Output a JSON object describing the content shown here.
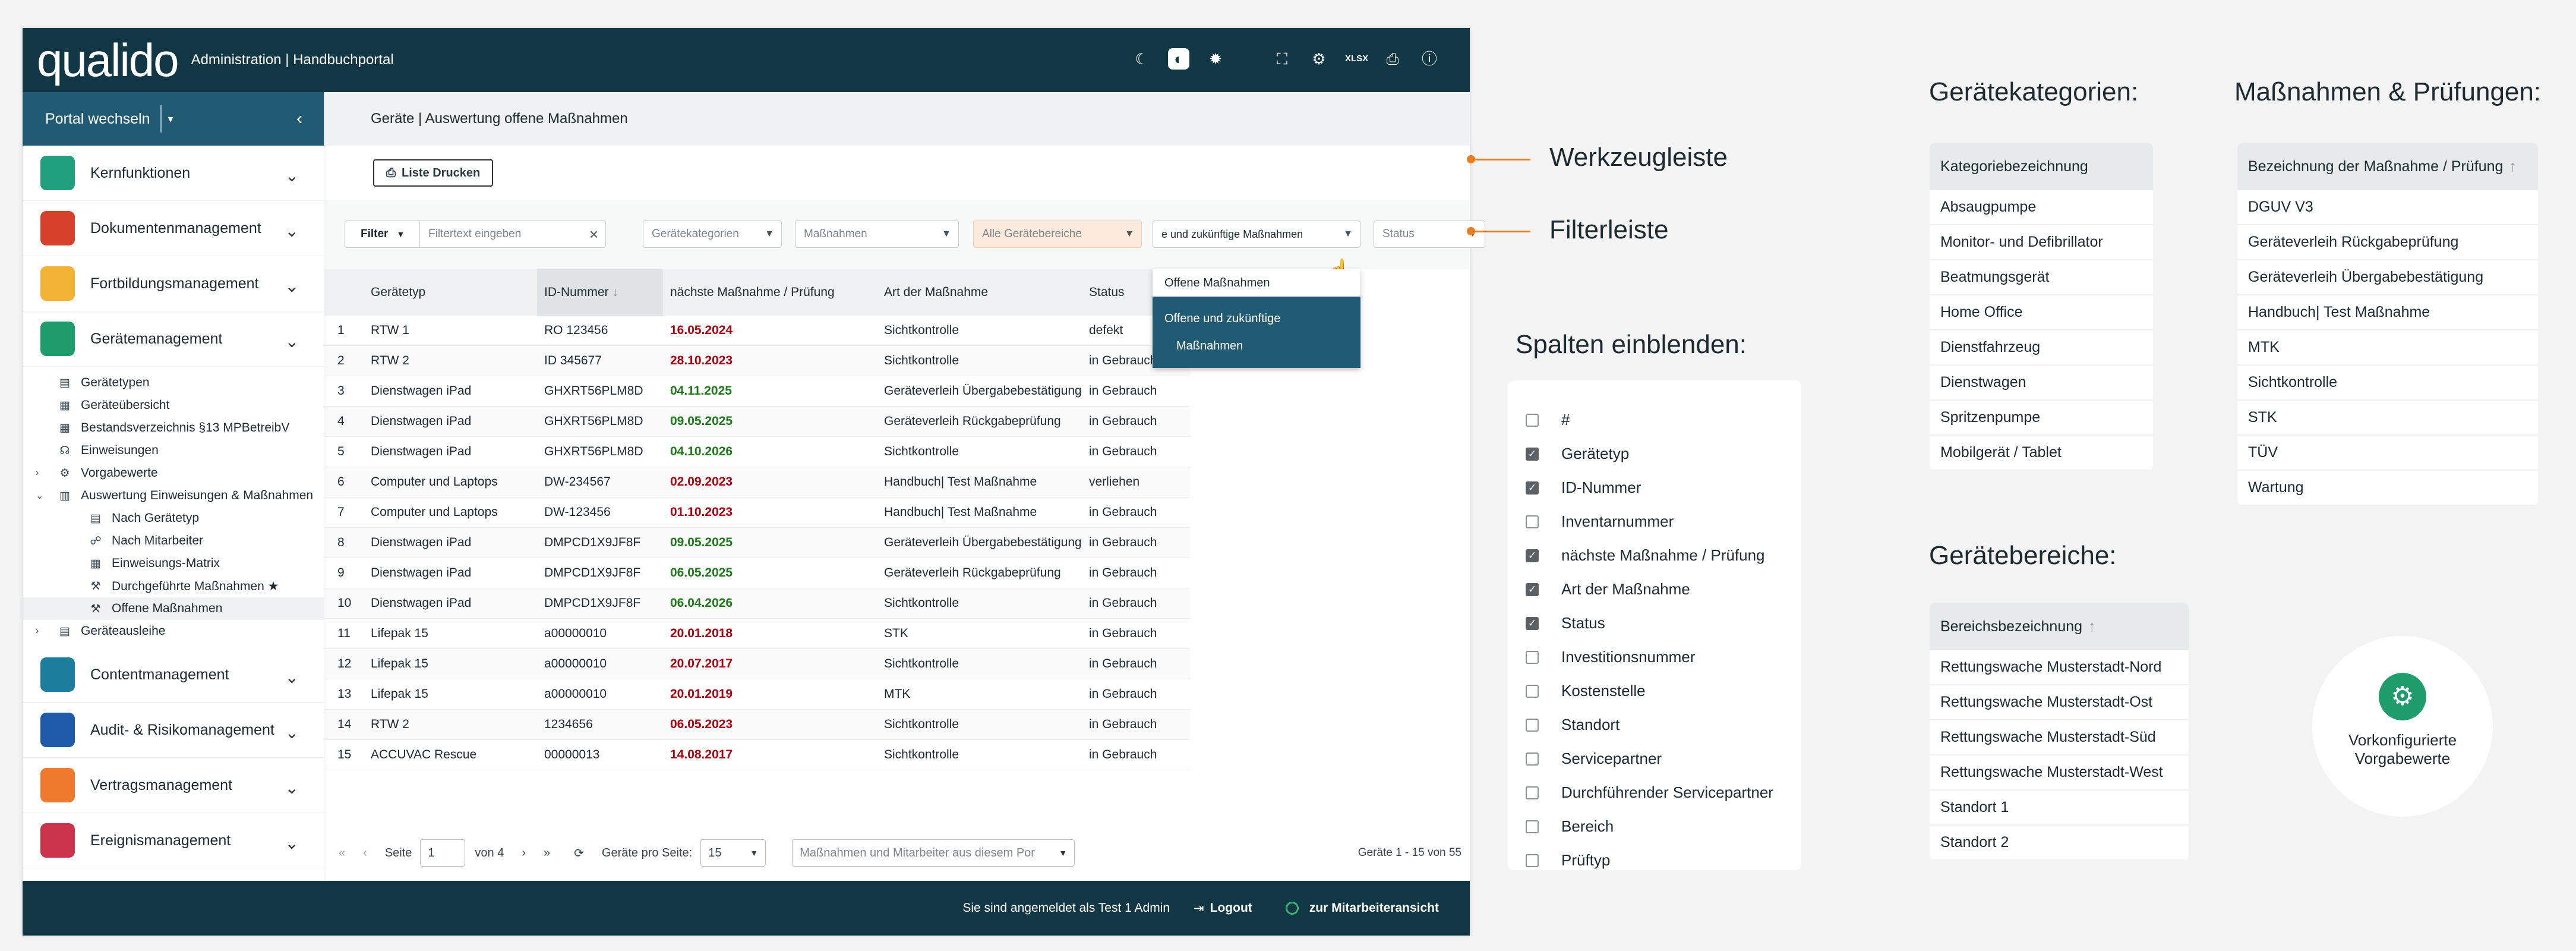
{
  "header": {
    "logo": "qualido",
    "title": "Administration | Handbuchportal"
  },
  "sidebar": {
    "portal_label": "Portal wechseln",
    "sections_top": [
      {
        "label": "Kernfunktionen",
        "color": "#20a07c"
      },
      {
        "label": "Dokumentenmanagement",
        "color": "#d6412c"
      },
      {
        "label": "Fortbildungsmanagement",
        "color": "#f2b233"
      },
      {
        "label": "Gerätemanagement",
        "color": "#1e9c6c"
      }
    ],
    "tree": [
      {
        "label": "Gerätetypen",
        "indent": 1
      },
      {
        "label": "Geräteübersicht",
        "indent": 1
      },
      {
        "label": "Bestandsverzeichnis §13 MPBetreibV",
        "indent": 1
      },
      {
        "label": "Einweisungen",
        "indent": 1
      },
      {
        "label": "Vorgabewerte",
        "indent": 1,
        "arrow": true
      },
      {
        "label": "Auswertung Einweisungen & Maßnahmen",
        "indent": 1,
        "arrow": true,
        "open": true
      },
      {
        "label": "Nach Gerätetyp",
        "indent": 2
      },
      {
        "label": "Nach Mitarbeiter",
        "indent": 2
      },
      {
        "label": "Einweisungs-Matrix",
        "indent": 2
      },
      {
        "label": "Durchgeführte Maßnahmen ★",
        "indent": 2
      },
      {
        "label": "Offene Maßnahmen",
        "indent": 2,
        "selected": true
      },
      {
        "label": "Geräteausleihe",
        "indent": 1,
        "arrow": true
      }
    ],
    "sections_bottom": [
      {
        "label": "Contentmanagement",
        "color": "#1d7d9c"
      },
      {
        "label": "Audit- & Risikomanagement",
        "color": "#1f5aa8"
      },
      {
        "label": "Vertragsmanagement",
        "color": "#ef7a2e"
      },
      {
        "label": "Ereignismanagement",
        "color": "#c9344a"
      }
    ]
  },
  "main": {
    "breadcrumb": "Geräte | Auswertung offene Maßnahmen",
    "print_button": "Liste Drucken",
    "filter": {
      "label": "Filter",
      "text_placeholder": "Filtertext eingeben",
      "categories": "Gerätekategorien",
      "measures": "Maßnahmen",
      "areas": "Alle Gerätebereiche",
      "open_select": "e und zukünftige Maßnahmen",
      "status": "Status"
    },
    "dropdown": {
      "option1": "Offene Maßnahmen",
      "option2_line1": "Offene und zukünftige",
      "option2_line2": "Maßnahmen"
    },
    "columns": [
      "",
      "Gerätetyp",
      "ID-Nummer",
      "nächste Maßnahme / Prüfung",
      "Art der Maßnahme",
      "Status"
    ],
    "rows": [
      [
        "1",
        "RTW 1",
        "RO 123456",
        "16.05.2024",
        "red",
        "Sichtkontrolle",
        "defekt"
      ],
      [
        "2",
        "RTW 2",
        "ID 345677",
        "28.10.2023",
        "red",
        "Sichtkontrolle",
        "in Gebrauch"
      ],
      [
        "3",
        "Dienstwagen iPad",
        "GHXRT56PLM8D",
        "04.11.2025",
        "green",
        "Geräteverleih Übergabebestätigung",
        "in Gebrauch"
      ],
      [
        "4",
        "Dienstwagen iPad",
        "GHXRT56PLM8D",
        "09.05.2025",
        "green",
        "Geräteverleih Rückgabeprüfung",
        "in Gebrauch"
      ],
      [
        "5",
        "Dienstwagen iPad",
        "GHXRT56PLM8D",
        "04.10.2026",
        "green",
        "Sichtkontrolle",
        "in Gebrauch"
      ],
      [
        "6",
        "Computer und Laptops",
        "DW-234567",
        "02.09.2023",
        "red",
        "Handbuch| Test Maßnahme",
        "verliehen"
      ],
      [
        "7",
        "Computer und Laptops",
        "DW-123456",
        "01.10.2023",
        "red",
        "Handbuch| Test Maßnahme",
        "in Gebrauch"
      ],
      [
        "8",
        "Dienstwagen iPad",
        "DMPCD1X9JF8F",
        "09.05.2025",
        "green",
        "Geräteverleih Übergabebestätigung",
        "in Gebrauch"
      ],
      [
        "9",
        "Dienstwagen iPad",
        "DMPCD1X9JF8F",
        "06.05.2025",
        "green",
        "Geräteverleih Rückgabeprüfung",
        "in Gebrauch"
      ],
      [
        "10",
        "Dienstwagen iPad",
        "DMPCD1X9JF8F",
        "06.04.2026",
        "green",
        "Sichtkontrolle",
        "in Gebrauch"
      ],
      [
        "11",
        "Lifepak 15",
        "a00000010",
        "20.01.2018",
        "red",
        "STK",
        "in Gebrauch"
      ],
      [
        "12",
        "Lifepak 15",
        "a00000010",
        "20.07.2017",
        "red",
        "Sichtkontrolle",
        "in Gebrauch"
      ],
      [
        "13",
        "Lifepak 15",
        "a00000010",
        "20.01.2019",
        "red",
        "MTK",
        "in Gebrauch"
      ],
      [
        "14",
        "RTW 2",
        "1234656",
        "06.05.2023",
        "red",
        "Sichtkontrolle",
        "in Gebrauch"
      ],
      [
        "15",
        "ACCUVAC Rescue",
        "00000013",
        "14.08.2017",
        "red",
        "Sichtkontrolle",
        "in Gebrauch"
      ]
    ],
    "pager": {
      "page_label": "Seite",
      "page_value": "1",
      "of": "von 4",
      "per_page_label": "Geräte pro Seite:",
      "per_page": "15",
      "scope": "Maßnahmen und Mitarbeiter aus diesem Por",
      "count": "Geräte 1 - 15 von 55"
    }
  },
  "footer": {
    "logged_in": "Sie sind angemeldet als Test 1 Admin",
    "logout": "Logout",
    "employee_view": "zur Mitarbeiteransicht"
  },
  "annotations": {
    "toolbar": "Werkzeugleiste",
    "filterbar": "Filterleiste"
  },
  "columns_panel": {
    "title": "Spalten einblenden:",
    "items": [
      {
        "label": "#",
        "on": false
      },
      {
        "label": "Gerätetyp",
        "on": true
      },
      {
        "label": "ID-Nummer",
        "on": true
      },
      {
        "label": "Inventarnummer",
        "on": false
      },
      {
        "label": "nächste Maßnahme / Prüfung",
        "on": true
      },
      {
        "label": "Art der Maßnahme",
        "on": true
      },
      {
        "label": "Status",
        "on": true
      },
      {
        "label": "Investitionsnummer",
        "on": false
      },
      {
        "label": "Kostenstelle",
        "on": false
      },
      {
        "label": "Standort",
        "on": false
      },
      {
        "label": "Servicepartner",
        "on": false
      },
      {
        "label": "Durchführender Servicepartner",
        "on": false
      },
      {
        "label": "Bereich",
        "on": false
      },
      {
        "label": "Prüftyp",
        "on": false
      }
    ]
  },
  "categories_panel": {
    "title": "Gerätekategorien:",
    "header": "Kategoriebezeichnung",
    "items": [
      "Absaugpumpe",
      "Monitor- und Defibrillator",
      "Beatmungsgerät",
      "Home Office",
      "Dienstfahrzeug",
      "Dienstwagen",
      "Spritzenpumpe",
      "Mobilgerät / Tablet"
    ]
  },
  "measures_panel": {
    "title": "Maßnahmen & Prüfungen:",
    "header": "Bezeichnung der Maßnahme / Prüfung",
    "items": [
      "DGUV V3",
      "Geräteverleih Rückgabeprüfung",
      "Geräteverleih Übergabebestätigung",
      "Handbuch| Test Maßnahme",
      "MTK",
      "Sichtkontrolle",
      "STK",
      "TÜV",
      "Wartung"
    ]
  },
  "areas_panel": {
    "title": "Gerätebereiche:",
    "header": "Bereichsbezeichnung",
    "items": [
      "Rettungswache Musterstadt-Nord",
      "Rettungswache Musterstadt-Ost",
      "Rettungswache Musterstadt-Süd",
      "Rettungswache Musterstadt-West",
      "Standort 1",
      "Standort 2"
    ]
  },
  "preconfig": {
    "line1": "Vorkonfigurierte",
    "line2": "Vorgabewerte"
  }
}
